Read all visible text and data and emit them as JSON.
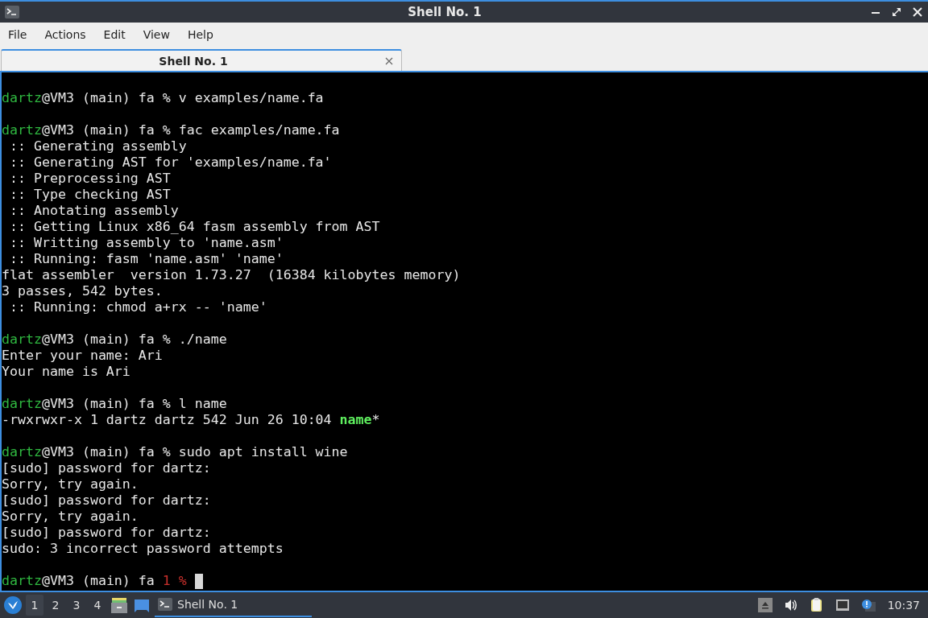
{
  "window": {
    "title": "Shell No. 1"
  },
  "menu": [
    "File",
    "Actions",
    "Edit",
    "View",
    "Help"
  ],
  "tabs": [
    {
      "label": "Shell No. 1",
      "selected": true
    }
  ],
  "terminal": {
    "cursor": true,
    "lines": [
      {
        "kind": "blank"
      },
      {
        "kind": "text",
        "segments": [
          {
            "kind": "user",
            "text": "dartz"
          },
          {
            "kind": "plain",
            "text": "@VM3 (main) fa % v examples/name.fa"
          }
        ]
      },
      {
        "kind": "blank"
      },
      {
        "kind": "text",
        "segments": [
          {
            "kind": "user",
            "text": "dartz"
          },
          {
            "kind": "plain",
            "text": "@VM3 (main) fa % fac examples/name.fa"
          }
        ]
      },
      {
        "kind": "text",
        "segments": [
          {
            "kind": "plain",
            "text": " :: Generating assembly"
          }
        ]
      },
      {
        "kind": "text",
        "segments": [
          {
            "kind": "plain",
            "text": " :: Generating AST for 'examples/name.fa'"
          }
        ]
      },
      {
        "kind": "text",
        "segments": [
          {
            "kind": "plain",
            "text": " :: Preprocessing AST"
          }
        ]
      },
      {
        "kind": "text",
        "segments": [
          {
            "kind": "plain",
            "text": " :: Type checking AST"
          }
        ]
      },
      {
        "kind": "text",
        "segments": [
          {
            "kind": "plain",
            "text": " :: Anotating assembly"
          }
        ]
      },
      {
        "kind": "text",
        "segments": [
          {
            "kind": "plain",
            "text": " :: Getting Linux x86_64 fasm assembly from AST"
          }
        ]
      },
      {
        "kind": "text",
        "segments": [
          {
            "kind": "plain",
            "text": " :: Writting assembly to 'name.asm'"
          }
        ]
      },
      {
        "kind": "text",
        "segments": [
          {
            "kind": "plain",
            "text": " :: Running: fasm 'name.asm' 'name'"
          }
        ]
      },
      {
        "kind": "text",
        "segments": [
          {
            "kind": "plain",
            "text": "flat assembler  version 1.73.27  (16384 kilobytes memory)"
          }
        ]
      },
      {
        "kind": "text",
        "segments": [
          {
            "kind": "plain",
            "text": "3 passes, 542 bytes."
          }
        ]
      },
      {
        "kind": "text",
        "segments": [
          {
            "kind": "plain",
            "text": " :: Running: chmod a+rx -- 'name'"
          }
        ]
      },
      {
        "kind": "blank"
      },
      {
        "kind": "text",
        "segments": [
          {
            "kind": "user",
            "text": "dartz"
          },
          {
            "kind": "plain",
            "text": "@VM3 (main) fa % ./name"
          }
        ]
      },
      {
        "kind": "text",
        "segments": [
          {
            "kind": "plain",
            "text": "Enter your name: Ari"
          }
        ]
      },
      {
        "kind": "text",
        "segments": [
          {
            "kind": "plain",
            "text": "Your name is Ari"
          }
        ]
      },
      {
        "kind": "blank"
      },
      {
        "kind": "text",
        "segments": [
          {
            "kind": "user",
            "text": "dartz"
          },
          {
            "kind": "plain",
            "text": "@VM3 (main) fa % l name"
          }
        ]
      },
      {
        "kind": "text",
        "segments": [
          {
            "kind": "plain",
            "text": "-rwxrwxr-x 1 dartz dartz 542 Jun 26 10:04 "
          },
          {
            "kind": "exec",
            "text": "name"
          },
          {
            "kind": "plain",
            "text": "*"
          }
        ]
      },
      {
        "kind": "blank"
      },
      {
        "kind": "text",
        "segments": [
          {
            "kind": "user",
            "text": "dartz"
          },
          {
            "kind": "plain",
            "text": "@VM3 (main) fa % sudo apt install wine"
          }
        ]
      },
      {
        "kind": "text",
        "segments": [
          {
            "kind": "plain",
            "text": "[sudo] password for dartz:"
          }
        ]
      },
      {
        "kind": "text",
        "segments": [
          {
            "kind": "plain",
            "text": "Sorry, try again."
          }
        ]
      },
      {
        "kind": "text",
        "segments": [
          {
            "kind": "plain",
            "text": "[sudo] password for dartz:"
          }
        ]
      },
      {
        "kind": "text",
        "segments": [
          {
            "kind": "plain",
            "text": "Sorry, try again."
          }
        ]
      },
      {
        "kind": "text",
        "segments": [
          {
            "kind": "plain",
            "text": "[sudo] password for dartz:"
          }
        ]
      },
      {
        "kind": "text",
        "segments": [
          {
            "kind": "plain",
            "text": "sudo: 3 incorrect password attempts"
          }
        ]
      },
      {
        "kind": "blank"
      },
      {
        "kind": "text",
        "segments": [
          {
            "kind": "user",
            "text": "dartz"
          },
          {
            "kind": "plain",
            "text": "@VM3 (main) fa "
          },
          {
            "kind": "error",
            "text": "1 %"
          }
        ]
      }
    ]
  },
  "taskbar": {
    "workspaces": [
      {
        "label": "1",
        "selected": true
      },
      {
        "label": "2",
        "selected": false
      },
      {
        "label": "3",
        "selected": false
      },
      {
        "label": "4",
        "selected": false
      }
    ],
    "tasks": [
      {
        "label": "Shell No. 1",
        "selected": true
      }
    ],
    "clock": "10:37"
  }
}
